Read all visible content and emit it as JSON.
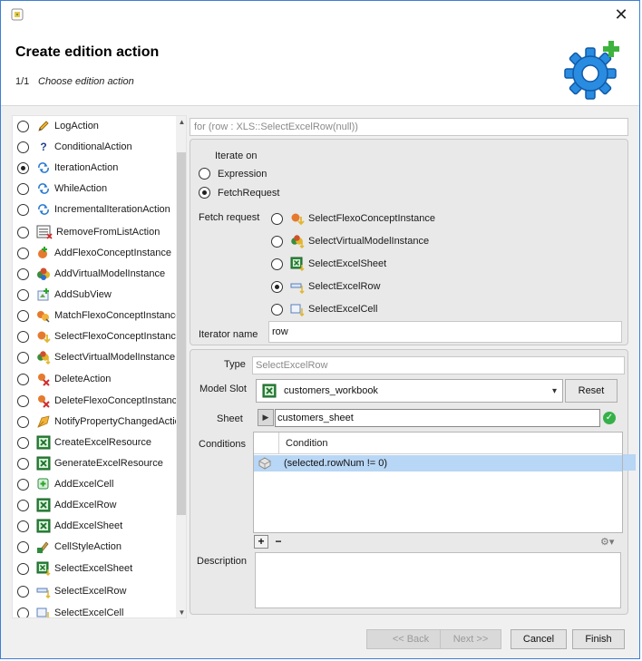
{
  "header": {
    "title": "Create edition action",
    "step": "1/1",
    "subtitle": "Choose edition action"
  },
  "window": {
    "close_icon": "close-icon"
  },
  "actions": {
    "items": [
      {
        "label": "LogAction",
        "icon": "pencil-icon",
        "checked": false
      },
      {
        "label": "ConditionalAction",
        "icon": "question-icon",
        "checked": false
      },
      {
        "label": "IterationAction",
        "icon": "loop-icon",
        "checked": true
      },
      {
        "label": "WhileAction",
        "icon": "loop-icon",
        "checked": false
      },
      {
        "label": "IncrementalIterationAction",
        "icon": "loop-icon",
        "checked": false
      },
      {
        "label": "RemoveFromListAction",
        "icon": "list-remove-icon",
        "checked": false
      },
      {
        "label": "AddFlexoConceptInstance",
        "icon": "flexo-concept-add-icon",
        "checked": false
      },
      {
        "label": "AddVirtualModelInstance",
        "icon": "virtual-model-add-icon",
        "checked": false
      },
      {
        "label": "AddSubView",
        "icon": "subview-add-icon",
        "checked": false
      },
      {
        "label": "MatchFlexoConceptInstance",
        "icon": "flexo-concept-match-icon",
        "checked": false
      },
      {
        "label": "SelectFlexoConceptInstance",
        "icon": "flexo-concept-select-icon",
        "checked": false
      },
      {
        "label": "SelectVirtualModelInstance",
        "icon": "virtual-model-select-icon",
        "checked": false
      },
      {
        "label": "DeleteAction",
        "icon": "delete-icon",
        "checked": false
      },
      {
        "label": "DeleteFlexoConceptInstance",
        "icon": "delete-icon",
        "checked": false
      },
      {
        "label": "NotifyPropertyChangedAction",
        "icon": "notify-icon",
        "checked": false
      },
      {
        "label": "CreateExcelResource",
        "icon": "excel-icon",
        "checked": false
      },
      {
        "label": "GenerateExcelResource",
        "icon": "excel-icon",
        "checked": false
      },
      {
        "label": "AddExcelCell",
        "icon": "excel-cell-add-icon",
        "checked": false
      },
      {
        "label": "AddExcelRow",
        "icon": "excel-row-add-icon",
        "checked": false
      },
      {
        "label": "AddExcelSheet",
        "icon": "excel-sheet-add-icon",
        "checked": false
      },
      {
        "label": "CellStyleAction",
        "icon": "cell-style-icon",
        "checked": false
      },
      {
        "label": "SelectExcelSheet",
        "icon": "excel-sheet-select-icon",
        "checked": false
      },
      {
        "label": "SelectExcelRow",
        "icon": "excel-row-select-icon",
        "checked": false
      },
      {
        "label": "SelectExcelCell",
        "icon": "excel-cell-select-icon",
        "checked": false
      }
    ]
  },
  "iteration": {
    "expression": "for (row : XLS::SelectExcelRow(null))",
    "iterate_on_label": "Iterate on",
    "iterate_options": [
      {
        "label": "Expression",
        "checked": false
      },
      {
        "label": "FetchRequest",
        "checked": true
      }
    ],
    "fetch_request_label": "Fetch request",
    "fetch_requests": [
      {
        "label": "SelectFlexoConceptInstance",
        "icon": "flexo-concept-select-icon",
        "checked": false
      },
      {
        "label": "SelectVirtualModelInstance",
        "icon": "virtual-model-select-icon",
        "checked": false
      },
      {
        "label": "SelectExcelSheet",
        "icon": "excel-sheet-select-icon",
        "checked": false
      },
      {
        "label": "SelectExcelRow",
        "icon": "excel-row-select-icon",
        "checked": true
      },
      {
        "label": "SelectExcelCell",
        "icon": "excel-cell-select-icon",
        "checked": false
      }
    ],
    "iterator_name_label": "Iterator name",
    "iterator_name": "row"
  },
  "fetch_details": {
    "type_label": "Type",
    "type_value": "SelectExcelRow",
    "model_slot_label": "Model Slot",
    "model_slot_value": "customers_workbook",
    "reset_label": "Reset",
    "sheet_label": "Sheet",
    "sheet_value": "customers_sheet",
    "conditions_label": "Conditions",
    "condition_column": "Condition",
    "conditions": [
      "(selected.rowNum != 0)"
    ],
    "add_label": "+",
    "remove_label": "−",
    "description_label": "Description",
    "description_value": ""
  },
  "footer": {
    "back_label": "<< Back",
    "next_label": "Next >>",
    "cancel_label": "Cancel",
    "finish_label": "Finish"
  }
}
